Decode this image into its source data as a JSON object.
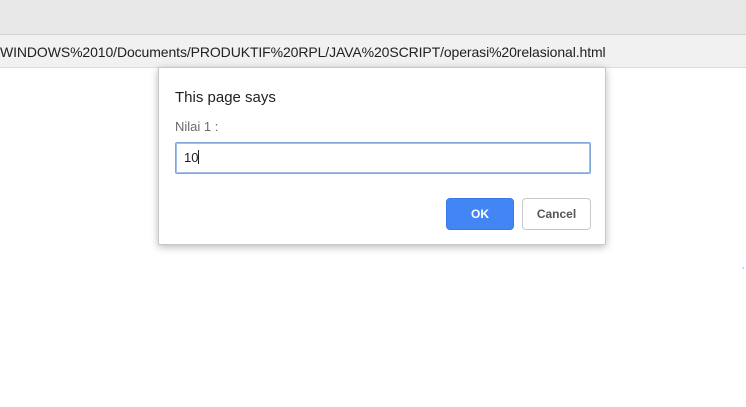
{
  "browser": {
    "url": "WINDOWS%2010/Documents/PRODUKTIF%20RPL/JAVA%20SCRIPT/operasi%20relasional.html"
  },
  "dialog": {
    "title": "This page says",
    "message": "Nilai 1 :",
    "input_value": "10",
    "ok_label": "OK",
    "cancel_label": "Cancel"
  },
  "colors": {
    "ok_button": "#4285f4",
    "input_focus_border": "#7ea6d8"
  }
}
